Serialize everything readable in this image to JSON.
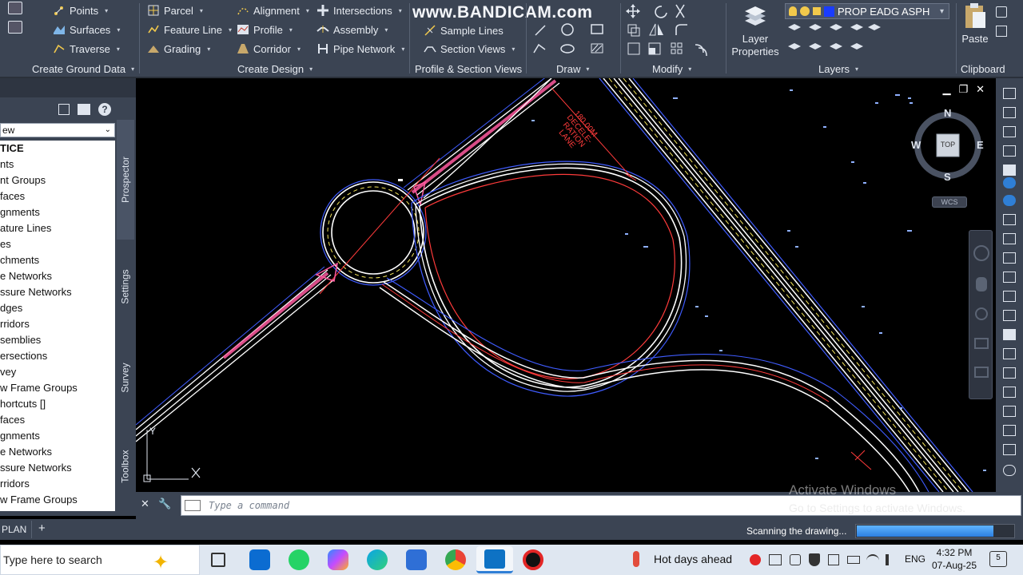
{
  "ribbon": {
    "create_ground": {
      "items": [
        "Points",
        "Surfaces",
        "Traverse"
      ],
      "title": "Create Ground Data"
    },
    "create_design": {
      "col1": [
        "Parcel",
        "Feature Line",
        "Grading"
      ],
      "col2": [
        "Alignment",
        "Profile",
        "Corridor"
      ],
      "col3": [
        "Intersections",
        "Assembly",
        "Pipe Network"
      ],
      "title": "Create Design"
    },
    "profile_section": {
      "items": [
        "Sample Lines",
        "Section Views"
      ],
      "title": "Profile & Section Views"
    },
    "draw_title": "Draw",
    "modify_title": "Modify",
    "layer_properties": "Layer Properties",
    "layers": {
      "current_layer": "PROP EADG ASPH",
      "title": "Layers"
    },
    "clipboard": {
      "paste": "Paste",
      "title": "Clipboard"
    }
  },
  "watermark": "www.BANDICAM.com",
  "toolspace": {
    "view_dropdown": "ew",
    "tree_items": [
      "TICE",
      "nts",
      "nt Groups",
      "faces",
      "gnments",
      "ature Lines",
      "es",
      "chments",
      "e Networks",
      "ssure Networks",
      "dges",
      "rridors",
      "semblies",
      "ersections",
      "vey",
      "w Frame Groups",
      "hortcuts []",
      "faces",
      "gnments",
      "e Networks",
      "ssure Networks",
      "rridors",
      "w Frame Groups"
    ],
    "tabs": [
      "Prospector",
      "Settings",
      "Survey",
      "Toolbox"
    ]
  },
  "drawing": {
    "viewcube": {
      "n": "N",
      "s": "S",
      "e": "E",
      "w": "W",
      "top": "TOP",
      "wcs": "WCS"
    },
    "annotation_lines": [
      "180.00M",
      "DECELE-",
      "RATION",
      "LANE"
    ],
    "ucs_y": "Y",
    "colors": {
      "background": "#000000",
      "road_edge": "#ffffff",
      "blue_offset": "#3f5cff",
      "red_line": "#ff3b3b",
      "yellow_dash": "#f2e35a",
      "pink_fill": "#ff5aa0"
    }
  },
  "command_line": {
    "placeholder": "Type a command"
  },
  "status": {
    "layout_tab": "PLAN",
    "scanning_text": "Scanning the drawing...",
    "scan_progress": 0.87
  },
  "activation": {
    "line1": "Activate Windows",
    "line2": "Go to Settings to activate Windows."
  },
  "taskbar": {
    "search_text": "Type here to search",
    "weather": "Hot days ahead",
    "language": "ENG",
    "time": "4:32 PM",
    "date": "07-Aug-25",
    "notification_count": "5"
  }
}
